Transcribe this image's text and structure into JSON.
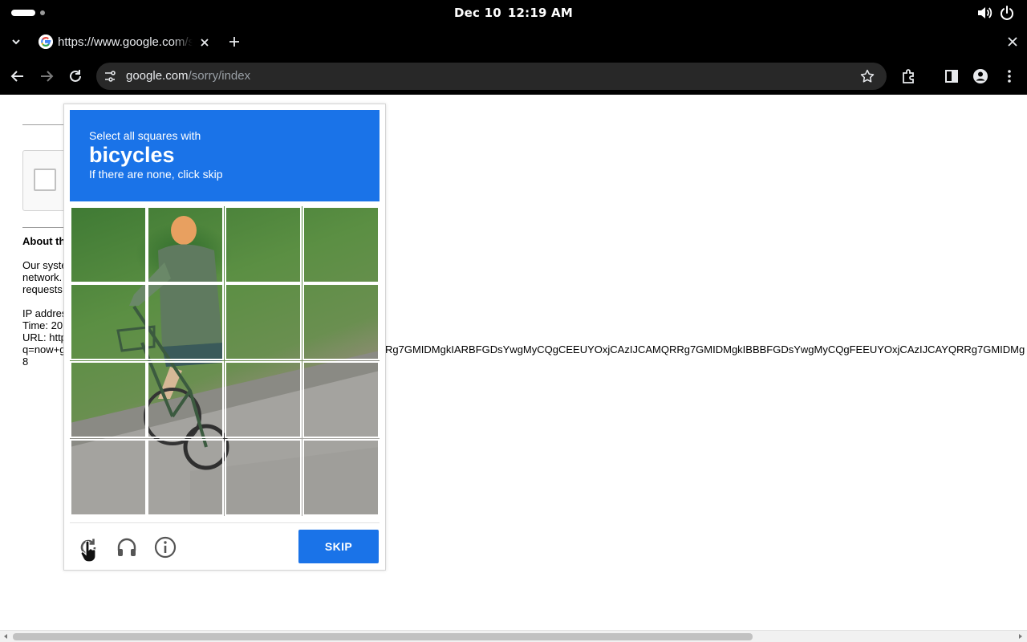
{
  "os_bar": {
    "date": "Dec 10",
    "time": "12:19 AM",
    "icons": [
      "activities-icon",
      "volume-icon",
      "power-icon"
    ]
  },
  "browser": {
    "tab": {
      "title": "https://www.google.com/sorry/index",
      "favicon": "google-g-icon"
    },
    "address": {
      "host": "google.com",
      "path": "/sorry/index"
    },
    "toolbar_icons": [
      "back-icon",
      "forward-icon",
      "reload-icon",
      "site-info-icon",
      "star-icon",
      "extensions-icon",
      "side-panel-icon",
      "profile-icon",
      "menu-icon"
    ]
  },
  "page": {
    "about_heading": "About th",
    "paragraph_lines": [
      "Our syste",
      "network.",
      "requests"
    ],
    "ip_label": "IP addres",
    "time_label": "Time: 20",
    "url_label": "URL: http",
    "query_start": "q=now+g",
    "last_line": "8",
    "url_tail": "Rg7GMIDMgkIARBFGDsYwgMyCQgCEEUYOxjCAzIJCAMQRRg7GMIDMgkIBBBFGDsYwgMyCQgFEEUYOxjCAzIJCAYQRRg7GMIDMg"
  },
  "captcha": {
    "instruction": "Select all squares with",
    "keyword": "bicycles",
    "hint": "If there are none, click skip",
    "grid_size": 4,
    "tile_count": 16,
    "skip_label": "SKIP",
    "footer_icons": [
      "reload-icon",
      "audio-headphones-icon",
      "info-icon"
    ],
    "accent_color": "#1a73e8"
  }
}
